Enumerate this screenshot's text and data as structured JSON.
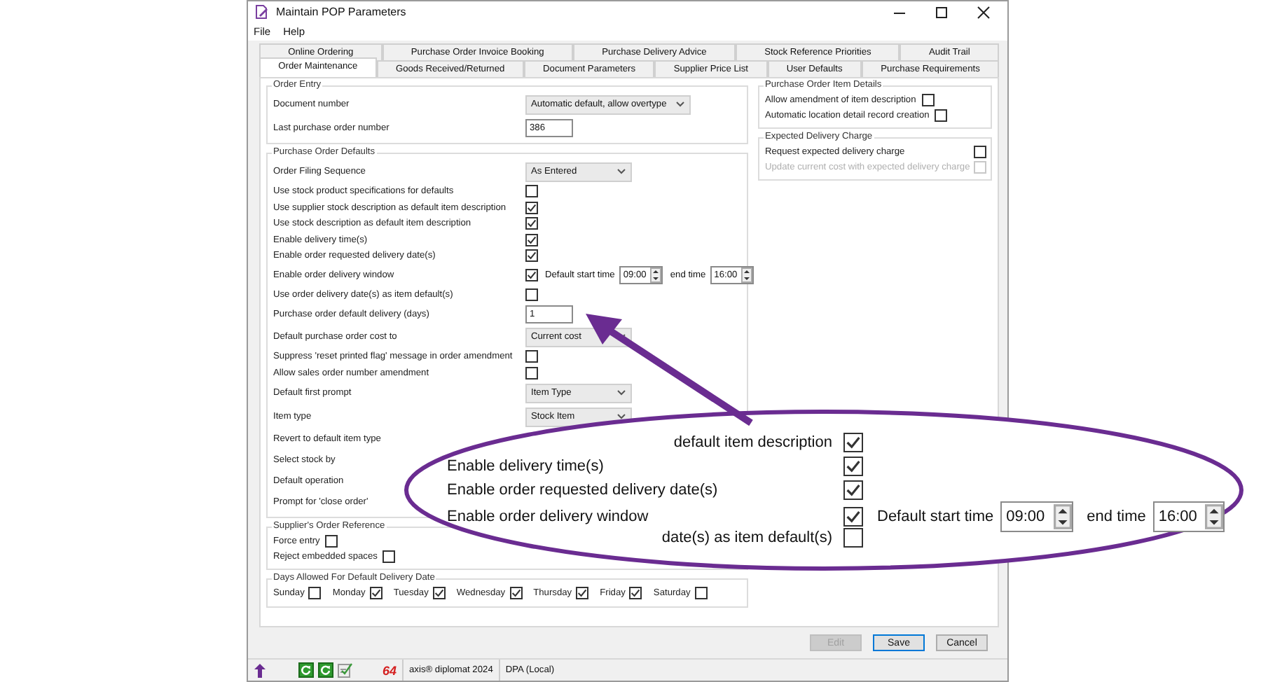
{
  "window": {
    "title": "Maintain POP Parameters"
  },
  "menu": [
    {
      "label": "File"
    },
    {
      "label": "Help"
    }
  ],
  "tab_rows": [
    [
      {
        "label": "Online Ordering",
        "selected": false
      },
      {
        "label": "Purchase Order Invoice Booking",
        "selected": false
      },
      {
        "label": "Purchase Delivery Advice",
        "selected": false
      },
      {
        "label": "Stock Reference Priorities",
        "selected": false
      },
      {
        "label": "Audit Trail",
        "selected": false
      }
    ],
    [
      {
        "label": "Order Maintenance",
        "selected": true
      },
      {
        "label": "Goods Received/Returned",
        "selected": false
      },
      {
        "label": "Document Parameters",
        "selected": false
      },
      {
        "label": "Supplier Price List",
        "selected": false
      },
      {
        "label": "User Defaults",
        "selected": false
      },
      {
        "label": "Purchase Requirements",
        "selected": false
      }
    ]
  ],
  "left_groups": [
    {
      "title": "Order Entry",
      "kind": "form",
      "rows": [
        {
          "kind": "select",
          "label": "Document number",
          "value": "Automatic default, allow overtype"
        },
        {
          "kind": "input",
          "label": "Last purchase order number",
          "value": "386"
        }
      ]
    },
    {
      "title": "Purchase Order Defaults",
      "kind": "form",
      "rows": [
        {
          "kind": "select",
          "label": "Order Filing Sequence",
          "value": "As Entered"
        },
        {
          "kind": "check",
          "label": "Use stock product specifications for defaults",
          "checked": false
        },
        {
          "kind": "check",
          "label": "Use supplier stock description as default item description",
          "checked": true
        },
        {
          "kind": "check",
          "label": "Use stock description as default item description",
          "checked": true
        },
        {
          "kind": "check",
          "label": "Enable delivery time(s)",
          "checked": true
        },
        {
          "kind": "check",
          "label": "Enable order requested delivery date(s)",
          "checked": true
        },
        {
          "kind": "check_times",
          "label": "Enable order delivery window",
          "checked": true,
          "start_label": "Default start time",
          "start": "09:00",
          "end_label": "end time",
          "end": "16:00"
        },
        {
          "kind": "check",
          "label": "Use order delivery date(s) as item default(s)",
          "checked": false
        },
        {
          "kind": "input",
          "label": "Purchase order default delivery (days)",
          "value": "1"
        },
        {
          "kind": "select",
          "label": "Default purchase order cost to",
          "value": "Current cost"
        },
        {
          "kind": "check",
          "label": "Suppress 'reset printed flag' message in order amendment",
          "checked": false
        },
        {
          "kind": "check",
          "label": "Allow sales order number amendment",
          "checked": false
        },
        {
          "kind": "select",
          "label": "Default first prompt",
          "value": "Item Type"
        },
        {
          "kind": "select",
          "label": "Item type",
          "value": "Stock Item"
        },
        {
          "kind": "label",
          "label": "Revert to default item type"
        },
        {
          "kind": "label",
          "label": "Select stock by"
        },
        {
          "kind": "label",
          "label": "Default operation"
        },
        {
          "kind": "label",
          "label": "Prompt for 'close order'"
        }
      ]
    },
    {
      "title": "Supplier's Order Reference",
      "kind": "compact",
      "rows": [
        {
          "kind": "check",
          "label": "Force entry",
          "checked": false
        },
        {
          "kind": "check",
          "label": "Reject embedded spaces",
          "checked": false
        }
      ]
    },
    {
      "title": "Days Allowed For Default Delivery Date",
      "kind": "inline",
      "rows": [
        {
          "kind": "check",
          "label": "Sunday",
          "checked": false
        },
        {
          "kind": "check",
          "label": "Monday",
          "checked": true
        },
        {
          "kind": "check",
          "label": "Tuesday",
          "checked": true
        },
        {
          "kind": "check",
          "label": "Wednesday",
          "checked": true
        },
        {
          "kind": "check",
          "label": "Thursday",
          "checked": true
        },
        {
          "kind": "check",
          "label": "Friday",
          "checked": true
        },
        {
          "kind": "check",
          "label": "Saturday",
          "checked": false
        }
      ]
    }
  ],
  "right_groups": [
    {
      "title": "Purchase Order Item Details",
      "kind": "compact",
      "rows": [
        {
          "kind": "check",
          "label": "Allow amendment of item description",
          "checked": false
        },
        {
          "kind": "check",
          "label": "Automatic location detail record creation",
          "checked": false
        }
      ]
    },
    {
      "title": "Expected Delivery Charge",
      "kind": "right",
      "rows": [
        {
          "kind": "check",
          "label": "Request expected delivery charge",
          "checked": false,
          "disabled": false
        },
        {
          "kind": "check",
          "label": "Update current cost with expected delivery charge",
          "checked": false,
          "disabled": true
        }
      ]
    }
  ],
  "buttons": [
    {
      "label": "Edit",
      "disabled": true,
      "default": false
    },
    {
      "label": "Save",
      "disabled": false,
      "default": true
    },
    {
      "label": "Cancel",
      "disabled": false,
      "default": false
    }
  ],
  "status_bar": {
    "logo": "64",
    "product": "axis® diplomat 2024",
    "connection": "DPA (Local)"
  },
  "callout": {
    "rows": [
      {
        "kind": "cut",
        "text": "default item description",
        "checked": true
      },
      {
        "kind": "full",
        "text": "Enable delivery time(s)",
        "checked": true
      },
      {
        "kind": "full",
        "text": "Enable order requested delivery date(s)",
        "checked": true
      },
      {
        "kind": "times",
        "text": "Enable order delivery window",
        "checked": true,
        "start_label": "Default start time",
        "start": "09:00",
        "end_label": "end time",
        "end": "16:00"
      },
      {
        "kind": "cut",
        "text": "date(s) as item default(s)",
        "checked": false
      }
    ]
  }
}
